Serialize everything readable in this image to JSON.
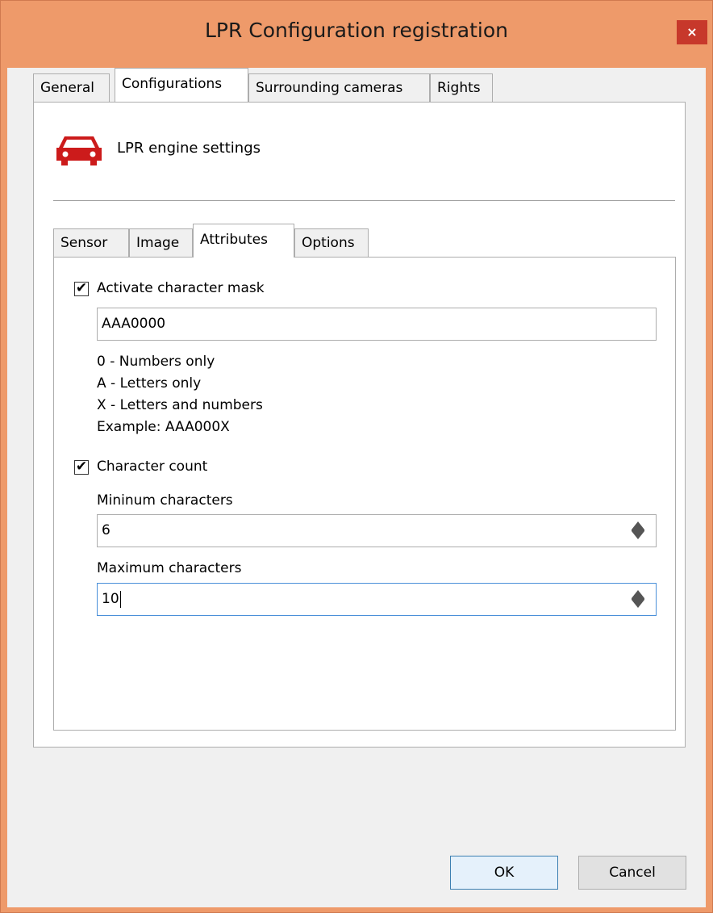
{
  "window": {
    "title": "LPR Configuration registration",
    "close_label": "×"
  },
  "tabs": [
    "General",
    "Configurations",
    "Surrounding cameras",
    "Rights"
  ],
  "header": {
    "icon": "car-icon",
    "text": "LPR engine settings",
    "icon_color": "#cc1b1b"
  },
  "subtabs": [
    "Sensor",
    "Image",
    "Attributes",
    "Options"
  ],
  "attributes": {
    "mask_checkbox_label": "Activate character mask",
    "mask_checked": true,
    "mask_value": "AAA0000",
    "legend": [
      "0 - Numbers only",
      "A - Letters only",
      "X - Letters and numbers",
      "Example: AAA000X"
    ],
    "count_checkbox_label": "Character count",
    "count_checked": true,
    "min_label": "Mininum characters",
    "min_value": "6",
    "max_label": "Maximum characters",
    "max_value": "10"
  },
  "buttons": {
    "ok": "OK",
    "cancel": "Cancel"
  },
  "check_mark": "✔"
}
